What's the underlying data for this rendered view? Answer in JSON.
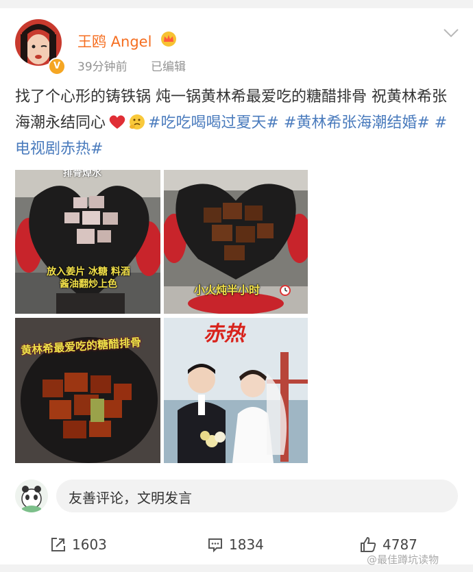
{
  "post": {
    "author": "王鸥 Angel",
    "time": "39分钟前",
    "edited": "已编辑",
    "text_plain": "找了个心形的铸铁锅 炖一锅黄林希最爱吃的糖醋排骨 祝黄林希张海潮永结同心",
    "hashtags": [
      "#吃吃喝喝过夏天#",
      "#黄林希张海潮结婚#",
      "#电视剧赤热#"
    ],
    "photos": [
      {
        "caption_top": "排骨焯水",
        "caption_bottom": "放入姜片 冰糖 料酒",
        "caption_bottom2": "酱油翻炒上色"
      },
      {
        "caption": "小火炖半小时"
      },
      {
        "caption": "黄林希最爱吃的糖醋排骨"
      },
      {
        "caption": "赤热"
      }
    ]
  },
  "comment": {
    "placeholder": "友善评论，文明发言"
  },
  "actions": {
    "share": "1603",
    "comment": "1834",
    "like": "4787"
  },
  "watermark": "@最佳蹲坑读物",
  "colors": {
    "username": "#f56e20",
    "hashtag": "#4a7bbd",
    "meta": "#939393"
  }
}
